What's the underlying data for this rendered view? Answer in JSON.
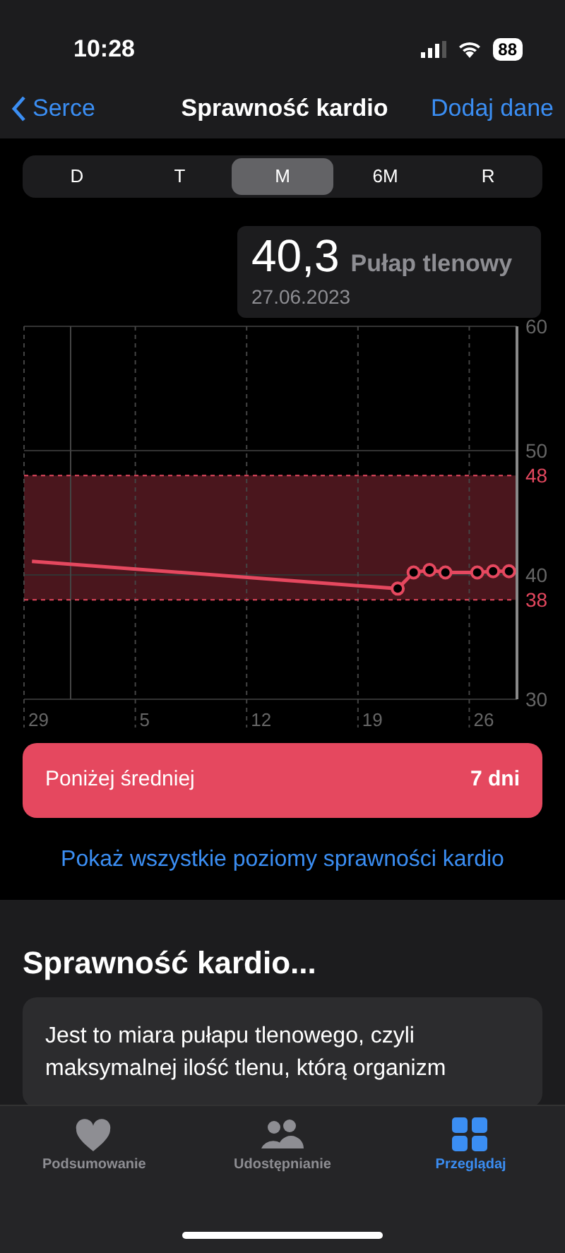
{
  "status_bar": {
    "time": "10:28",
    "battery": "88"
  },
  "nav": {
    "back": "Serce",
    "title": "Sprawność kardio",
    "action": "Dodaj dane"
  },
  "periods": [
    {
      "label": "D",
      "selected": false
    },
    {
      "label": "T",
      "selected": false
    },
    {
      "label": "M",
      "selected": true
    },
    {
      "label": "6M",
      "selected": false
    },
    {
      "label": "R",
      "selected": false
    }
  ],
  "tooltip": {
    "value": "40,3",
    "unit": "Pułap tlenowy",
    "date": "27.06.2023"
  },
  "chart_data": {
    "type": "line",
    "categories": [
      "29",
      null,
      null,
      null,
      null,
      null,
      null,
      "5",
      null,
      null,
      null,
      null,
      null,
      null,
      "12",
      null,
      null,
      null,
      null,
      null,
      null,
      "19",
      null,
      null,
      null,
      null,
      null,
      null,
      "26",
      null,
      null
    ],
    "series": [
      {
        "color": "#e5485f",
        "marker": "o",
        "values": [
          41.1,
          null,
          null,
          null,
          null,
          null,
          null,
          null,
          null,
          null,
          null,
          null,
          null,
          null,
          null,
          null,
          null,
          null,
          null,
          null,
          null,
          null,
          null,
          38.9,
          40.2,
          40.4,
          40.2,
          null,
          40.2,
          40.3,
          40.3
        ]
      }
    ],
    "ylim": [
      30,
      60
    ],
    "grid": true,
    "bands": [
      {
        "axis": "y",
        "from": 38,
        "to": 48,
        "color": "#4a161d"
      }
    ],
    "ref_lines": [
      {
        "axis": "y",
        "value": 48,
        "label": "48",
        "color": "#e5485f"
      },
      {
        "axis": "y",
        "value": 38,
        "label": "38",
        "color": "#e5485f"
      }
    ],
    "yticks": [
      30,
      40,
      50,
      60
    ]
  },
  "status_card": {
    "label": "Poniżej średniej",
    "value": "7 dni"
  },
  "link": "Pokaż wszystkie poziomy sprawności kardio",
  "about": {
    "title": "Sprawność kardio...",
    "text": "Jest to miara pułapu tlenowego, czyli maksymalnej ilość tlenu, którą organizm"
  },
  "tab_bar": [
    {
      "label": "Podsumowanie",
      "kind": "heart",
      "selected": false
    },
    {
      "label": "Udostępnianie",
      "kind": "people",
      "selected": false
    },
    {
      "label": "Przeglądaj",
      "kind": "grid",
      "selected": true
    }
  ]
}
